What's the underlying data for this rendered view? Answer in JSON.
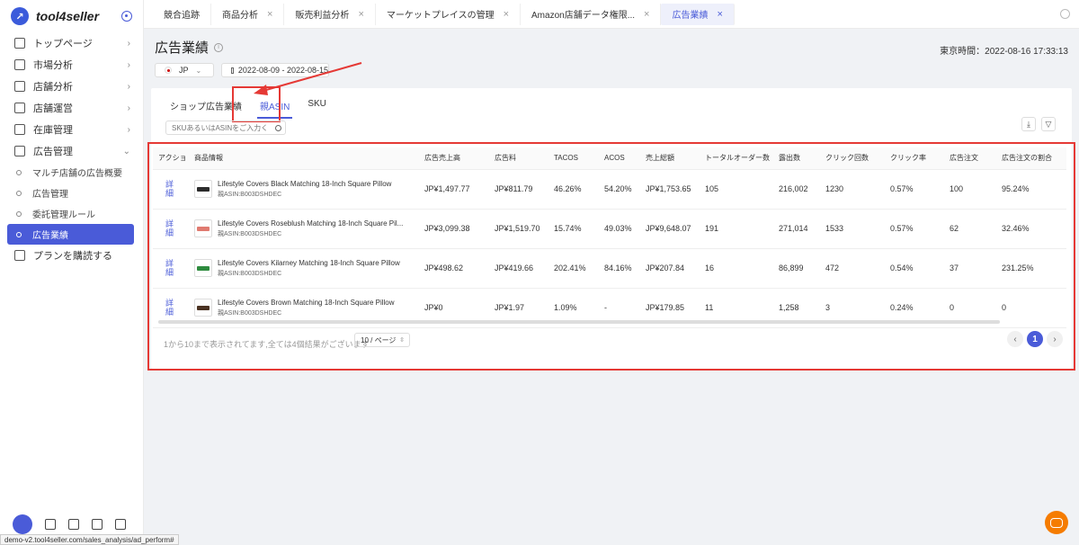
{
  "app": {
    "logo_text": "tool4seller"
  },
  "sidebar": {
    "items": [
      {
        "label": "トップページ",
        "icon": "home-icon"
      },
      {
        "label": "市場分析",
        "icon": "market-icon"
      },
      {
        "label": "店舗分析",
        "icon": "chart-icon"
      },
      {
        "label": "店舗運営",
        "icon": "store-icon"
      },
      {
        "label": "在庫管理",
        "icon": "inventory-icon"
      },
      {
        "label": "広告管理",
        "icon": "monitor-icon"
      }
    ],
    "sub_items": [
      {
        "label": "マルチ店舗の広告概要"
      },
      {
        "label": "広告管理"
      },
      {
        "label": "委託管理ルール"
      },
      {
        "label": "広告業績"
      }
    ],
    "plan_label": "プランを購読する"
  },
  "top_tabs": [
    {
      "label": "競合追跡"
    },
    {
      "label": "商品分析"
    },
    {
      "label": "販売利益分析"
    },
    {
      "label": "マーケットプレイスの管理"
    },
    {
      "label": "Amazon店舗データ権限..."
    },
    {
      "label": "広告業績"
    }
  ],
  "page": {
    "title": "広告業績",
    "tokyo_time": "東京時間：2022-08-16 17:33:13",
    "country": "JP",
    "date_range": "2022-08-09 - 2022-08-15"
  },
  "sub_tabs": [
    {
      "label": "ショップ広告業績"
    },
    {
      "label": "親ASIN"
    },
    {
      "label": "SKU"
    }
  ],
  "search": {
    "placeholder": "SKUあるいはASINをご入力く"
  },
  "table": {
    "headers": [
      "アクショ",
      "商品情報",
      "広告売上高",
      "広告料",
      "TACOS",
      "ACOS",
      "売上総額",
      "トータルオーダー数",
      "露出数",
      "クリック回数",
      "クリック率",
      "広告注文",
      "広告注文の割合"
    ],
    "detail_label": "詳細",
    "rows": [
      {
        "name": "Lifestyle Covers Black Matching 18-Inch Square Pillow",
        "asin": "親ASIN:B003DSHDEC",
        "color": "#2b2b2b",
        "ad_sales": "JP¥1,497.77",
        "ad_cost": "JP¥811.79",
        "tacos": "46.26%",
        "acos": "54.20%",
        "total_sales": "JP¥1,753.65",
        "orders": "105",
        "impressions": "216,002",
        "clicks": "1230",
        "ctr": "0.57%",
        "ad_orders": "100",
        "ad_order_ratio": "95.24%"
      },
      {
        "name": "Lifestyle Covers Roseblush Matching 18-Inch Square Pil...",
        "asin": "親ASIN:B003DSHDEC",
        "color": "#e07a70",
        "ad_sales": "JP¥3,099.38",
        "ad_cost": "JP¥1,519.70",
        "tacos": "15.74%",
        "acos": "49.03%",
        "total_sales": "JP¥9,648.07",
        "orders": "191",
        "impressions": "271,014",
        "clicks": "1533",
        "ctr": "0.57%",
        "ad_orders": "62",
        "ad_order_ratio": "32.46%"
      },
      {
        "name": "Lifestyle Covers Kilarney Matching 18-Inch Square Pillow",
        "asin": "親ASIN:B003DSHDEC",
        "color": "#2e8b3e",
        "ad_sales": "JP¥498.62",
        "ad_cost": "JP¥419.66",
        "tacos": "202.41%",
        "acos": "84.16%",
        "total_sales": "JP¥207.84",
        "orders": "16",
        "impressions": "86,899",
        "clicks": "472",
        "ctr": "0.54%",
        "ad_orders": "37",
        "ad_order_ratio": "231.25%"
      },
      {
        "name": "Lifestyle Covers Brown Matching 18-Inch Square Pillow",
        "asin": "親ASIN:B003DSHDEC",
        "color": "#4a3222",
        "ad_sales": "JP¥0",
        "ad_cost": "JP¥1.97",
        "tacos": "1.09%",
        "acos": "-",
        "total_sales": "JP¥179.85",
        "orders": "11",
        "impressions": "1,258",
        "clicks": "3",
        "ctr": "0.24%",
        "ad_orders": "0",
        "ad_order_ratio": "0"
      }
    ]
  },
  "pagination": {
    "summary": "1から10まで表示されてます,全ては4個結果がございます",
    "page_size": "10 / ページ",
    "current_page": "1"
  },
  "statusbar": {
    "url": "demo-v2.tool4seller.com/sales_analysis/ad_perform#"
  },
  "colors": {
    "accent": "#4a5bd8",
    "highlight": "#e53935",
    "chat": "#f57c00"
  }
}
